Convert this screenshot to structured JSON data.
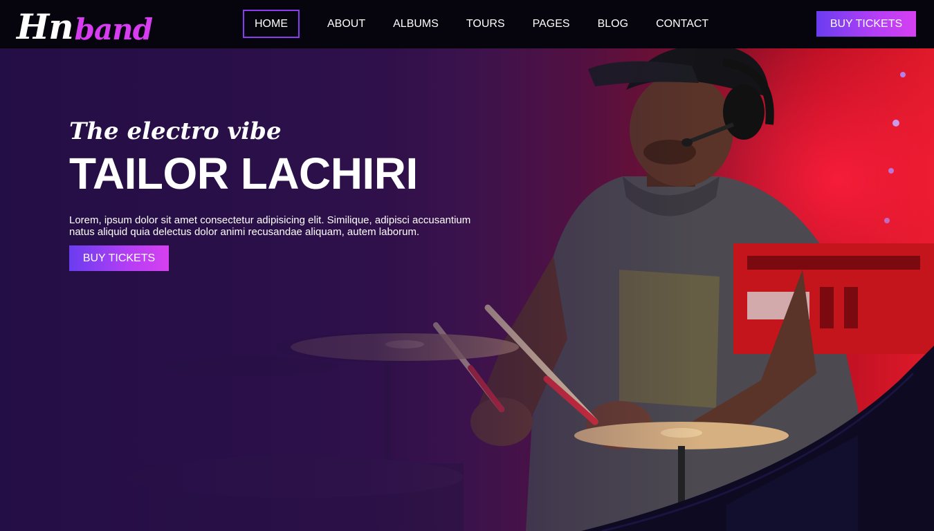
{
  "brand": {
    "logo_part1": "Hn",
    "logo_part2": "band"
  },
  "nav": {
    "items": [
      {
        "label": "HOME",
        "active": true
      },
      {
        "label": "ABOUT"
      },
      {
        "label": "ALBUMS"
      },
      {
        "label": "TOURS"
      },
      {
        "label": "PAGES"
      },
      {
        "label": "BLOG"
      },
      {
        "label": "CONTACT"
      }
    ],
    "cta_label": "BUY TICKETS"
  },
  "hero": {
    "tagline": "The electro vibe",
    "headline": "TAILOR LACHIRI",
    "description": "Lorem, ipsum dolor sit amet consectetur adipisicing elit. Similique, adipisci accusantium natus aliquid quia delectus dolor animi recusandae aliquam, autem laborum.",
    "cta_label": "BUY TICKETS"
  },
  "colors": {
    "accent_start": "#6a3df0",
    "accent_end": "#d640f0",
    "header_bg": "#06040d",
    "hero_left": "#2a1048",
    "hero_right": "#e01a2a",
    "curve_fill": "#0d0a22"
  }
}
